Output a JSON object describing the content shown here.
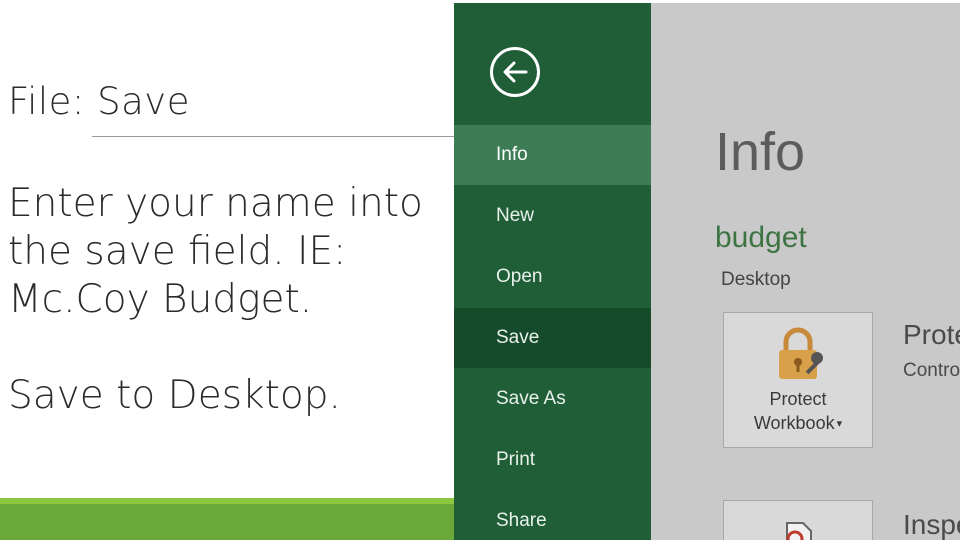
{
  "slide": {
    "title": "File: Save",
    "body_line_1": "Enter your name into the save field. IE: Mc.Coy Budget.",
    "body_line_2": "Save to Desktop."
  },
  "backstage": {
    "back_label": "",
    "nav_items": [
      {
        "label": "Info",
        "state": "active"
      },
      {
        "label": "New"
      },
      {
        "label": "Open"
      },
      {
        "label": "Save",
        "state": "pressed"
      },
      {
        "label": "Save As"
      },
      {
        "label": "Print"
      },
      {
        "label": "Share"
      }
    ]
  },
  "info": {
    "heading": "Info",
    "document_name": "budget",
    "location": "Desktop",
    "protect": {
      "tile_line_1": "Protect",
      "tile_line_2": "Workbook",
      "heading": "Prote",
      "description": "Contro"
    },
    "inspect": {
      "heading": "Inspe"
    }
  },
  "colors": {
    "nav_background": "#1f5e36",
    "nav_active": "#3e7c56",
    "accent_green": "#6aa83a",
    "doc_name_green": "#3e7443",
    "lock_gold": "#d9a04a"
  },
  "icons": [
    "back-arrow-icon",
    "lock-icon",
    "key-icon",
    "dropdown-caret-icon",
    "inspect-document-icon"
  ]
}
